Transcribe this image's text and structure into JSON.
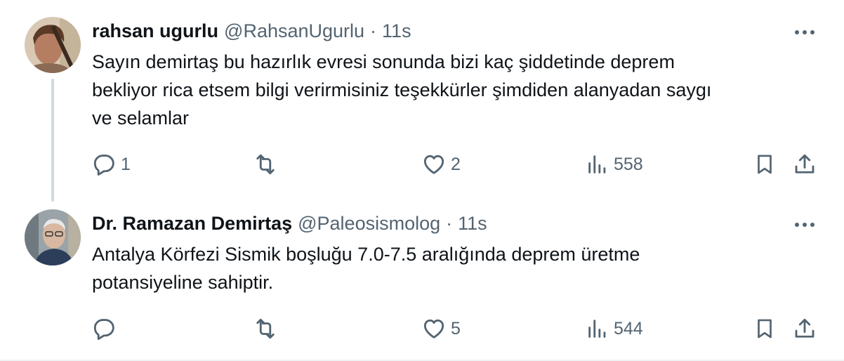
{
  "tweets": [
    {
      "display_name": "rahsan ugurlu",
      "handle": "@RahsanUgurlu",
      "separator": "·",
      "time": "11s",
      "text": "Sayın demirtaş  bu hazırlık evresi sonunda bizi kaç şiddetinde deprem\nbekliyor rica etsem bilgi verirmisiniz teşekkürler şimdiden alanyadan saygı\nve selamlar",
      "reply_count": "1",
      "retweet_count": "",
      "like_count": "2",
      "view_count": "558"
    },
    {
      "display_name": "Dr. Ramazan Demirtaş",
      "handle": "@Paleosismolog",
      "separator": "·",
      "time": "11s",
      "text": "Antalya Körfezi Sismik boşluğu 7.0-7.5 aralığında deprem üretme\npotansiyeline sahiptir.",
      "reply_count": "",
      "retweet_count": "",
      "like_count": "5",
      "view_count": "544"
    }
  ],
  "icons": {
    "reply": "speech-bubble-icon",
    "retweet": "retweet-arrows-icon",
    "like": "heart-icon",
    "views": "bar-chart-icon",
    "bookmark": "bookmark-icon",
    "share": "share-upload-icon",
    "more": "more-dots-icon"
  },
  "colors": {
    "text_primary": "#0f1419",
    "text_secondary": "#536471",
    "thread_line": "#cfd9de"
  }
}
